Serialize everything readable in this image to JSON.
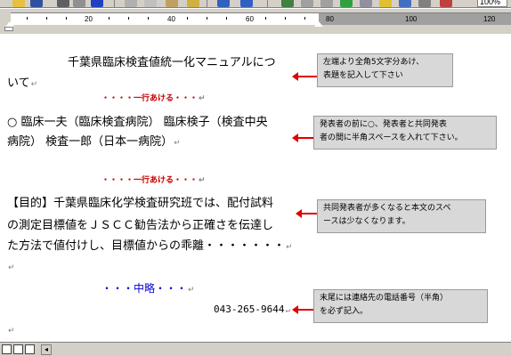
{
  "toolbar": {
    "zoom": "100%"
  },
  "ruler": {
    "marks": [
      "20",
      "40",
      "60",
      "80",
      "100",
      "120"
    ]
  },
  "document": {
    "title_line1": "千葉県臨床検査値統一化マニュアルにつ",
    "title_line2": "いて",
    "blank_note_1": "・・・・一行あける・・・",
    "authors_line1": "○ 臨床一夫（臨床検査病院） 臨床検子（検査中央",
    "authors_line2": "病院） 検査一郎（日本一病院）",
    "blank_note_2": "・・・・一行あける・・・",
    "body_line1": "【目的】千葉県臨床化学検査研究班では、配付試料",
    "body_line2": "の測定目標値をＪＳＣＣ勧告法から正確さを伝達し",
    "body_line3": "た方法で値付けし、目標値からの乖離・・・・・・・",
    "omitted": "・・・中略・・・",
    "phone": "043-265-9644",
    "paragraph_mark": "↵"
  },
  "notes": {
    "note1_line1": "左端より全角5文字分あけ、",
    "note1_line2": "表題を記入して下さい",
    "note2_line1": "発表者の前に○、発表者と共同発表",
    "note2_line2": "者の間に半角スペースを入れて下さい。",
    "note3_line1": "共同発表者が多くなると本文のスペ",
    "note3_line2": "ースは少なくなります。",
    "note4_line1": "末尾には連絡先の電話番号（半角）",
    "note4_line2": "を必ず記入。"
  },
  "colors": {
    "arrow": "#e00000",
    "blank_note": "#cc0000",
    "omitted": "#0000cc"
  },
  "icons": [
    "ruler-indent-marker-icon",
    "paragraph-mark-icon",
    "arrow-left-icon",
    "scroll-left-icon"
  ]
}
